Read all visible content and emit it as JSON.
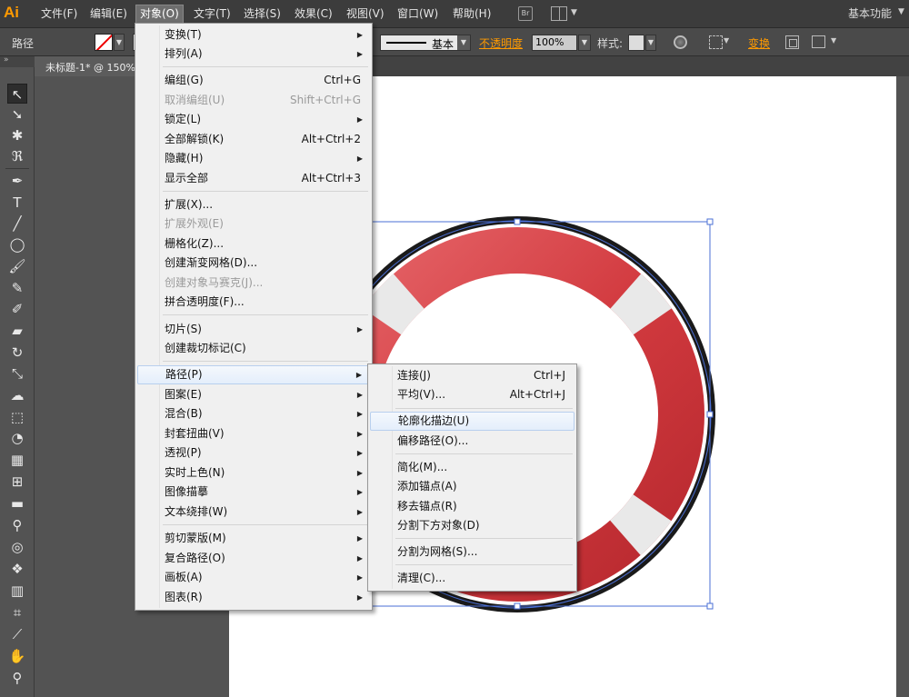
{
  "app": {
    "logo": "Ai",
    "menus": [
      "文件(F)",
      "编辑(E)",
      "对象(O)",
      "文字(T)",
      "选择(S)",
      "效果(C)",
      "视图(V)",
      "窗口(W)",
      "帮助(H)"
    ],
    "bridge_label": "Br",
    "workspace": "基本功能"
  },
  "control_bar": {
    "selection_label": "路径",
    "stroke_style": "基本",
    "opacity_label": "不透明度",
    "opacity_value": "100%",
    "style_label": "样式:",
    "transform_label": "变换"
  },
  "document": {
    "tab_title": "未标题-1* @ 150%"
  },
  "object_menu": {
    "items": [
      {
        "label": "变换(T)",
        "shortcut": "",
        "submenu": true,
        "disabled": false
      },
      {
        "label": "排列(A)",
        "shortcut": "",
        "submenu": true,
        "disabled": false
      },
      {
        "label": "编组(G)",
        "shortcut": "Ctrl+G",
        "submenu": false,
        "disabled": false
      },
      {
        "label": "取消编组(U)",
        "shortcut": "Shift+Ctrl+G",
        "submenu": false,
        "disabled": true
      },
      {
        "label": "锁定(L)",
        "shortcut": "",
        "submenu": true,
        "disabled": false
      },
      {
        "label": "全部解锁(K)",
        "shortcut": "Alt+Ctrl+2",
        "submenu": false,
        "disabled": false
      },
      {
        "label": "隐藏(H)",
        "shortcut": "",
        "submenu": true,
        "disabled": false
      },
      {
        "label": "显示全部",
        "shortcut": "Alt+Ctrl+3",
        "submenu": false,
        "disabled": false
      },
      {
        "label": "扩展(X)...",
        "shortcut": "",
        "submenu": false,
        "disabled": false
      },
      {
        "label": "扩展外观(E)",
        "shortcut": "",
        "submenu": false,
        "disabled": true
      },
      {
        "label": "栅格化(Z)...",
        "shortcut": "",
        "submenu": false,
        "disabled": false
      },
      {
        "label": "创建渐变网格(D)...",
        "shortcut": "",
        "submenu": false,
        "disabled": false
      },
      {
        "label": "创建对象马赛克(J)...",
        "shortcut": "",
        "submenu": false,
        "disabled": true
      },
      {
        "label": "拼合透明度(F)...",
        "shortcut": "",
        "submenu": false,
        "disabled": false
      },
      {
        "label": "切片(S)",
        "shortcut": "",
        "submenu": true,
        "disabled": false
      },
      {
        "label": "创建裁切标记(C)",
        "shortcut": "",
        "submenu": false,
        "disabled": false
      },
      {
        "label": "路径(P)",
        "shortcut": "",
        "submenu": true,
        "disabled": false,
        "highlighted": true
      },
      {
        "label": "图案(E)",
        "shortcut": "",
        "submenu": true,
        "disabled": false
      },
      {
        "label": "混合(B)",
        "shortcut": "",
        "submenu": true,
        "disabled": false
      },
      {
        "label": "封套扭曲(V)",
        "shortcut": "",
        "submenu": true,
        "disabled": false
      },
      {
        "label": "透视(P)",
        "shortcut": "",
        "submenu": true,
        "disabled": false
      },
      {
        "label": "实时上色(N)",
        "shortcut": "",
        "submenu": true,
        "disabled": false
      },
      {
        "label": "图像描摹",
        "shortcut": "",
        "submenu": true,
        "disabled": false
      },
      {
        "label": "文本绕排(W)",
        "shortcut": "",
        "submenu": true,
        "disabled": false
      },
      {
        "label": "剪切蒙版(M)",
        "shortcut": "",
        "submenu": true,
        "disabled": false
      },
      {
        "label": "复合路径(O)",
        "shortcut": "",
        "submenu": true,
        "disabled": false
      },
      {
        "label": "画板(A)",
        "shortcut": "",
        "submenu": true,
        "disabled": false
      },
      {
        "label": "图表(R)",
        "shortcut": "",
        "submenu": true,
        "disabled": false
      }
    ]
  },
  "path_submenu": {
    "items": [
      {
        "label": "连接(J)",
        "shortcut": "Ctrl+J"
      },
      {
        "label": "平均(V)...",
        "shortcut": "Alt+Ctrl+J"
      },
      {
        "label": "轮廓化描边(U)",
        "shortcut": "",
        "highlighted": true
      },
      {
        "label": "偏移路径(O)...",
        "shortcut": ""
      },
      {
        "label": "简化(M)...",
        "shortcut": ""
      },
      {
        "label": "添加锚点(A)",
        "shortcut": ""
      },
      {
        "label": "移去锚点(R)",
        "shortcut": ""
      },
      {
        "label": "分割下方对象(D)",
        "shortcut": ""
      },
      {
        "label": "分割为网格(S)...",
        "shortcut": ""
      },
      {
        "label": "清理(C)...",
        "shortcut": ""
      }
    ]
  },
  "icons": {
    "submenu_arrow": "▶",
    "dropdown_arrow": "▼"
  },
  "colors": {
    "accent": "#ff9a00",
    "ring_red": "#d23a3f",
    "ring_outline": "#1a1a1a",
    "selection": "#4a6fd6"
  }
}
